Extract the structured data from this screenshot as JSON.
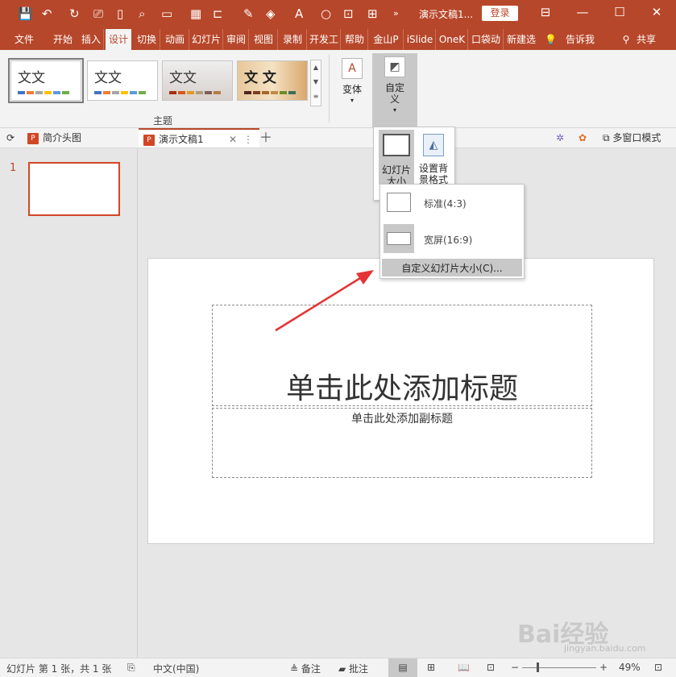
{
  "title_bar": {
    "doc_title": "演示文稿1...",
    "login": "登录",
    "qa_icons": [
      "save-icon",
      "undo-icon",
      "redo-icon",
      "present-icon",
      "new-icon",
      "print-preview-icon",
      "folder-icon",
      "grid-icon",
      "align-icon",
      "pen-icon",
      "fill-icon",
      "font-color-icon",
      "circle-icon",
      "crop-icon",
      "more-icon"
    ]
  },
  "tabs": [
    "文件",
    "开始",
    "插入",
    "设计",
    "切换",
    "动画",
    "幻灯片",
    "审阅",
    "视图",
    "录制",
    "开发工",
    "帮助",
    "金山P",
    "iSlide",
    "OneK",
    "口袋动",
    "新建选",
    "告诉我",
    "共享"
  ],
  "active_tab": "设计",
  "ribbon": {
    "theme_text": "文文",
    "theme_text_alt": "文 文",
    "theme_group_label": "主题",
    "variant_label": "变体",
    "custom_label": "自定义"
  },
  "doc_tabs": {
    "tab1": "简介头图",
    "tab2": "演示文稿1",
    "multi_window": "多窗口模式"
  },
  "thumbnail": {
    "number": "1"
  },
  "slide": {
    "title_placeholder": "单击此处添加标题",
    "subtitle_placeholder": "单击此处添加副标题"
  },
  "size_dropdown": {
    "slide_size": "幻灯片大小",
    "bg_format": "设置背景格式"
  },
  "size_menu": {
    "standard": "标准(4:3)",
    "widescreen": "宽屏(16:9)",
    "custom": "自定义幻灯片大小(C)..."
  },
  "status_bar": {
    "slide_info": "幻灯片 第 1 张，共 1 张",
    "language": "中文(中国)",
    "notes": "备注",
    "comments": "批注",
    "zoom": "49%"
  },
  "watermark": {
    "brand": "Bai经验",
    "url": "jingyan.baidu.com"
  },
  "colors": {
    "accent": "#b7472a",
    "arrow": "#e53333"
  }
}
